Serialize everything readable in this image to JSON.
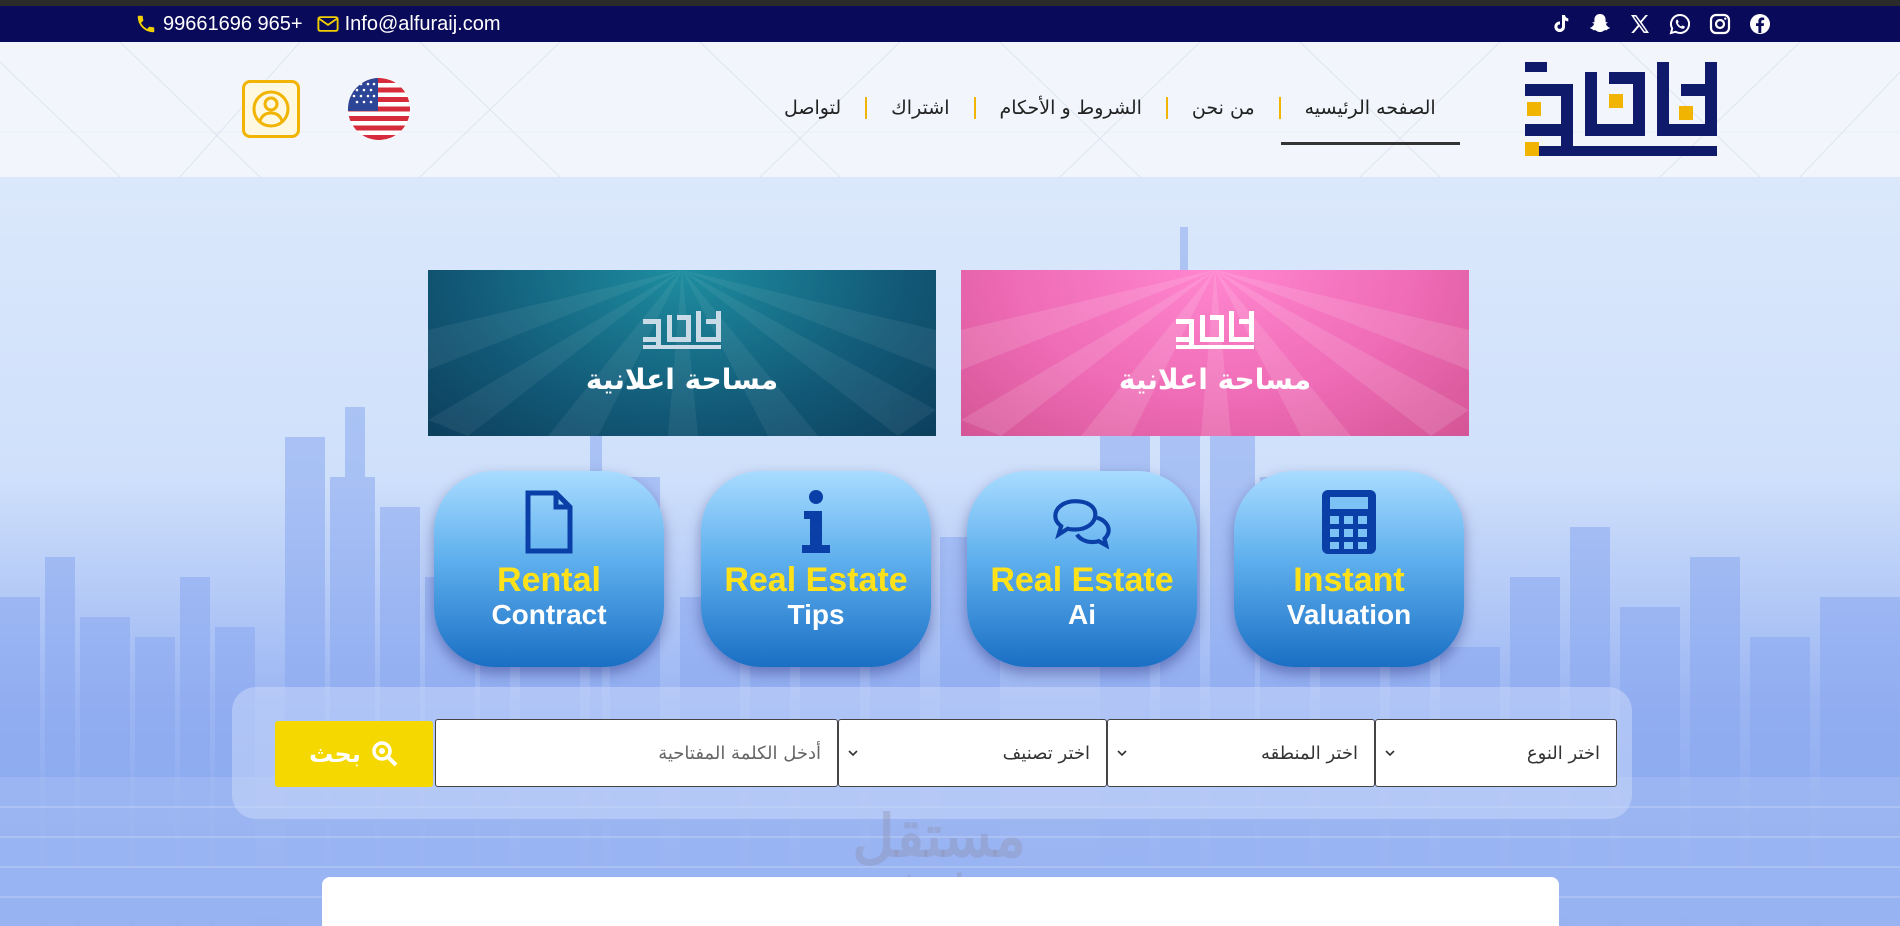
{
  "topbar": {
    "phone": "99661696 965+",
    "email": "Info@alfuraij.com",
    "socials": [
      "tiktok-icon",
      "snapchat-icon",
      "x-icon",
      "whatsapp-icon",
      "instagram-icon",
      "facebook-icon"
    ]
  },
  "nav": {
    "items": [
      "الصفحه الرئيسيه",
      "من نحن",
      "الشروط و الأحكام",
      "اشتراك",
      "لتواصل"
    ],
    "active_index": 0
  },
  "ads": [
    {
      "label": "مساحة اعلانية",
      "color": "#125a78"
    },
    {
      "label": "مساحة اعلانية",
      "color": "#ef6cb6"
    }
  ],
  "tiles": [
    {
      "line1": "Rental",
      "line2": "Contract",
      "icon": "document-icon"
    },
    {
      "line1": "Real Estate",
      "line2": "Tips",
      "icon": "info-icon"
    },
    {
      "line1": "Real Estate",
      "line2": "Ai",
      "icon": "chat-bubbles-icon"
    },
    {
      "line1": "Instant",
      "line2": "Valuation",
      "icon": "calculator-icon"
    }
  ],
  "search": {
    "button_label": "بحث",
    "keyword_placeholder": "أدخل الكلمة المفتاحية",
    "category_select": "اختر تصنيف",
    "region_select": "اختر المنطقه",
    "type_select": "اختر النوع"
  },
  "watermark": {
    "line1": "مستقل",
    "line2": "mostaql.com"
  },
  "colors": {
    "navy": "#0a0a5a",
    "accent": "#f1b400",
    "search_yellow": "#f4d800"
  }
}
